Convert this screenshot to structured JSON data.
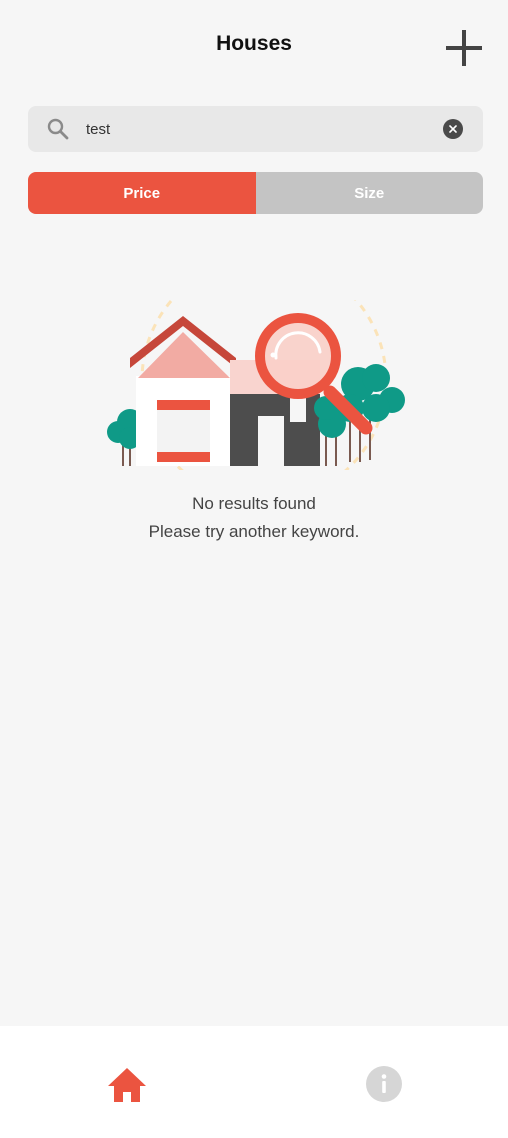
{
  "header": {
    "title": "Houses",
    "add_icon": "plus-icon"
  },
  "search": {
    "value": "test",
    "search_icon": "search-icon",
    "clear_icon": "clear-icon"
  },
  "sort_tabs": [
    {
      "label": "Price",
      "active": true
    },
    {
      "label": "Size",
      "active": false
    }
  ],
  "empty_state": {
    "illustration": "house-with-magnifier-illustration",
    "line1": "No results found",
    "line2": "Please try another keyword."
  },
  "bottom_nav": [
    {
      "icon": "home-icon",
      "active": true
    },
    {
      "icon": "info-icon",
      "active": false
    }
  ],
  "colors": {
    "accent": "#eb5440",
    "inactive_tab": "#c4c4c4",
    "background": "#f6f6f6",
    "search_bg": "#e8e8e8",
    "nav_inactive": "#d6d6d6",
    "tree": "#0f9a87"
  }
}
